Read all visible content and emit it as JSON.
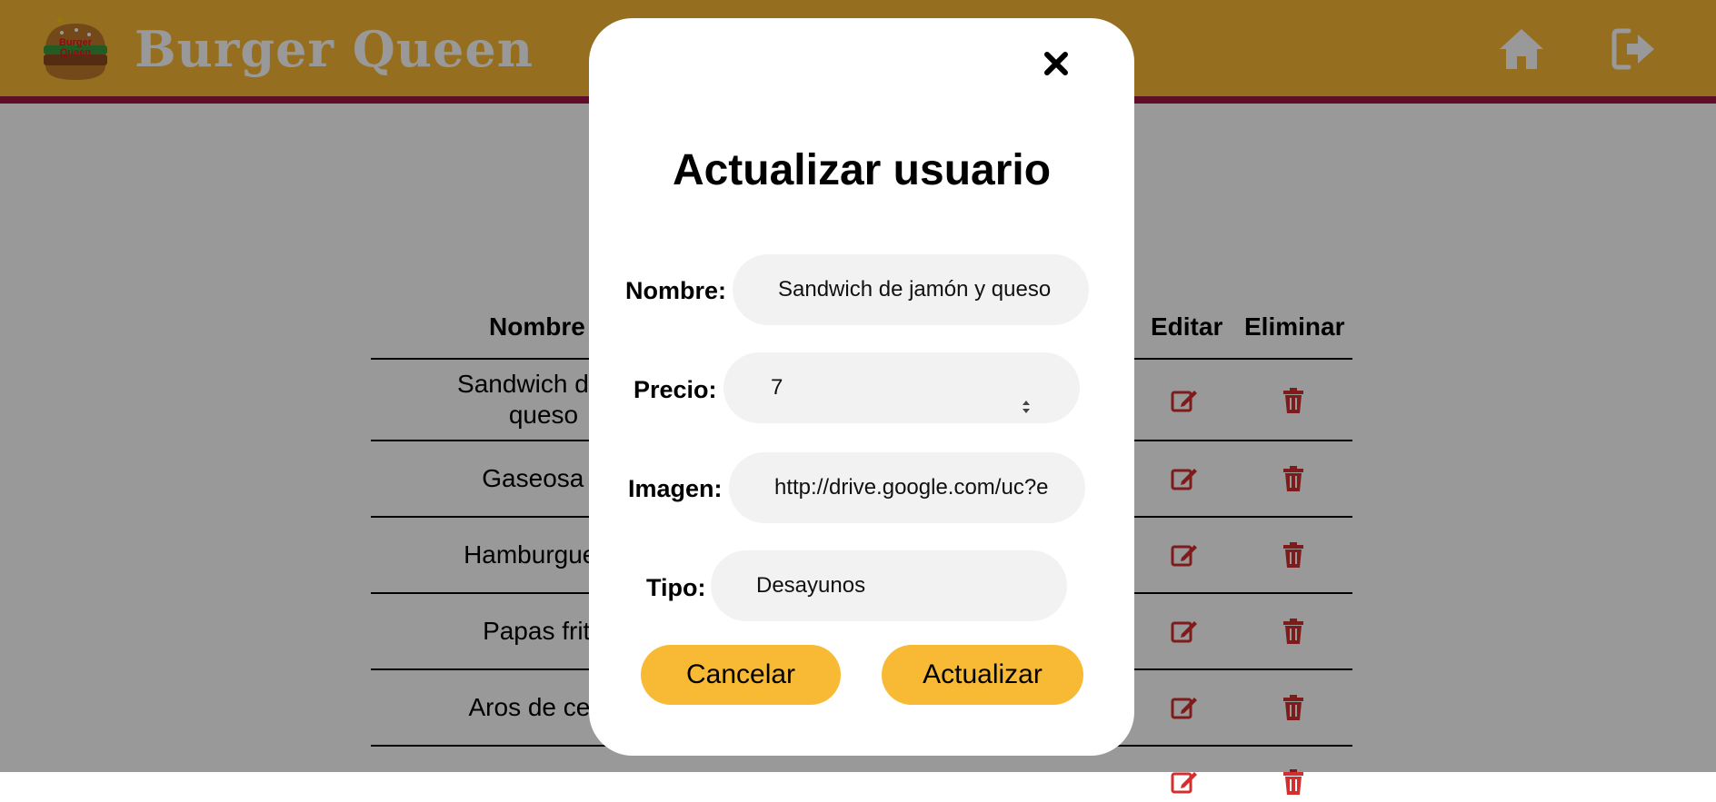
{
  "header": {
    "brand": "Burger Queen",
    "logo_text_line1": "Burger",
    "logo_text_line2": "Queen",
    "home_icon": "home-icon",
    "logout_icon": "logout-icon"
  },
  "table": {
    "headers": {
      "name": "Nombre",
      "edit": "Editar",
      "delete": "Eliminar"
    },
    "rows": [
      {
        "name_line1": "Sandwich de ja",
        "name_line2": "queso"
      },
      {
        "name_line1": "Gaseosa 1",
        "name_line2": ""
      },
      {
        "name_line1": "Hamburguesa",
        "name_line2": ""
      },
      {
        "name_line1": "Papas frita",
        "name_line2": ""
      },
      {
        "name_line1": "Aros de cebo",
        "name_line2": ""
      }
    ]
  },
  "modal": {
    "title": "Actualizar usuario",
    "fields": {
      "name_label": "Nombre:",
      "name_value": "Sandwich de jamón y queso",
      "price_label": "Precio:",
      "price_value": "7",
      "image_label": "Imagen:",
      "image_value": "http://drive.google.com/uc?e",
      "type_label": "Tipo:",
      "type_value": "Desayunos"
    },
    "cancel_label": "Cancelar",
    "update_label": "Actualizar",
    "close_icon": "close-icon"
  },
  "colors": {
    "header_bg": "#f8ba34",
    "header_border": "#a01645",
    "button_bg": "#f8ba34",
    "action_icon": "#d32f2f"
  }
}
